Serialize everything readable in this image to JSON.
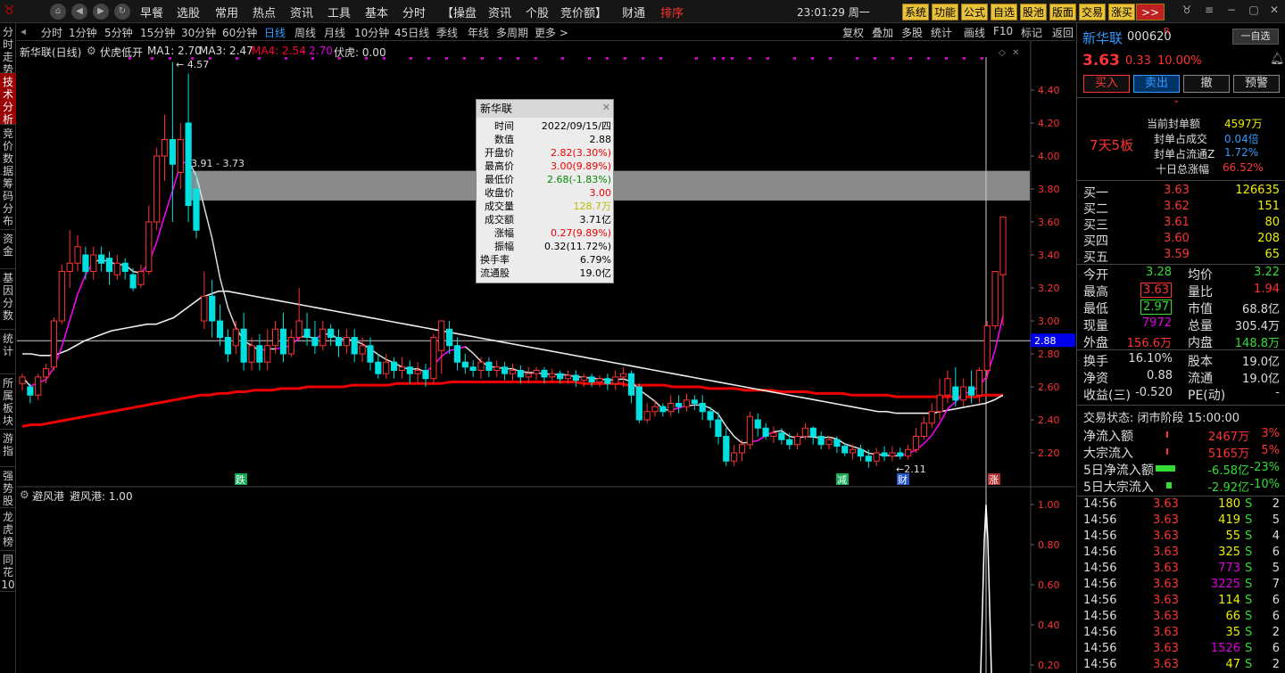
{
  "topbar": {
    "menus": [
      "早餐",
      "选股",
      "常用",
      "热点",
      "资讯",
      "工具",
      "基本",
      "分时",
      "【操盘",
      "资讯",
      "个股",
      "竞价额】",
      "财通",
      "排序"
    ],
    "clock": "23:01:29 周一",
    "tool_buttons": [
      "系统",
      "功能",
      "公式",
      "自选",
      "股池",
      "版面",
      "交易",
      "涨买"
    ]
  },
  "lefttabs": [
    "分时走势",
    "技术分析",
    "竞价数据",
    "筹码分布",
    "资金",
    "基因分数",
    "统计",
    "所属板块",
    "游指",
    "强势股",
    "龙虎榜",
    "同花10"
  ],
  "periods": [
    "分时",
    "1分钟",
    "5分钟",
    "15分钟",
    "30分钟",
    "60分钟",
    "日线",
    "周线",
    "月线",
    "10分钟",
    "45日线",
    "季线",
    "年线",
    "多周期",
    "更多 >"
  ],
  "active_period": "日线",
  "right_tools": [
    "复权",
    "叠加",
    "多股",
    "统计",
    "画线",
    "F10",
    "标记",
    "返回"
  ],
  "indicator_line": {
    "name": "新华联(日线)",
    "formula": "伏虎低开",
    "ma1": "MA1: 2.70",
    "ma3": "MA3: 2.47",
    "ma4": "MA4: 2.54",
    "ma4b": "- 2.70",
    "fuhu": "伏虎: 0.00"
  },
  "sub_indicator": {
    "name": "避风港",
    "value": "避风港: 1.00"
  },
  "annotations": {
    "high": "4.57",
    "range": "3.91 - 3.73",
    "low": "2.11",
    "crosshair": "2.88",
    "m1": "跌",
    "m2": "减",
    "m3": "财",
    "m4": "涨"
  },
  "tooltip": {
    "title": "新华联",
    "rows": [
      [
        "时间",
        "2022/09/15/四"
      ],
      [
        "数值",
        "2.88"
      ],
      [
        "开盘价",
        "2.82(3.30%)"
      ],
      [
        "最高价",
        "3.00(9.89%)"
      ],
      [
        "最低价",
        "2.68(-1.83%)"
      ],
      [
        "收盘价",
        "3.00"
      ],
      [
        "成交量",
        "128.7万"
      ],
      [
        "成交额",
        "3.71亿"
      ],
      [
        "涨幅",
        "0.27(9.89%)"
      ],
      [
        "振幅",
        "0.32(11.72%)"
      ],
      [
        "换手率",
        "6.79%"
      ],
      [
        "流通股",
        "19.0亿"
      ]
    ]
  },
  "stock": {
    "name": "新华联",
    "code": "000620",
    "flag": "R",
    "watch": "一自选",
    "price": "3.63",
    "change": "0.33",
    "pct": "10.00%"
  },
  "actions": [
    "买入",
    "卖出",
    "撤",
    "预警"
  ],
  "limit": {
    "streak": "7天5板",
    "rows": [
      [
        "当前封单额",
        "4597万"
      ],
      [
        "封单占成交",
        "0.04倍"
      ],
      [
        "封单占流通Z",
        "1.72%"
      ],
      [
        "十日总涨幅",
        "66.52%"
      ]
    ]
  },
  "orderbook": [
    [
      "买一",
      "3.63",
      "126635"
    ],
    [
      "买二",
      "3.62",
      "151"
    ],
    [
      "买三",
      "3.61",
      "80"
    ],
    [
      "买四",
      "3.60",
      "208"
    ],
    [
      "买五",
      "3.59",
      "65"
    ]
  ],
  "stats": [
    [
      "今开",
      "3.28",
      "均价",
      "3.22"
    ],
    [
      "最高",
      "3.63",
      "量比",
      "1.94"
    ],
    [
      "最低",
      "2.97",
      "市值",
      "68.8亿"
    ],
    [
      "现量",
      "7972",
      "总量",
      "305.4万"
    ],
    [
      "外盘",
      "156.6万",
      "内盘",
      "148.8万"
    ]
  ],
  "stats2": [
    [
      "换手",
      "16.10%",
      "股本",
      "19.0亿"
    ],
    [
      "净资",
      "0.88",
      "流通",
      "19.0亿"
    ],
    [
      "收益(三)",
      "-0.520",
      "PE(动)",
      "-"
    ]
  ],
  "trade_status": "交易状态: 闭市阶段 15:00:00",
  "flows": [
    [
      "净流入额",
      "2467万",
      "3%"
    ],
    [
      "大宗流入",
      "5165万",
      "5%"
    ],
    [
      "5日净流入额",
      "-6.58亿",
      "-23%"
    ],
    [
      "5日大宗流入",
      "-2.92亿",
      "-10%"
    ]
  ],
  "ticks": [
    [
      "14:56",
      "3.63",
      "180",
      "S",
      "2"
    ],
    [
      "14:56",
      "3.63",
      "419",
      "S",
      "5"
    ],
    [
      "14:56",
      "3.63",
      "55",
      "S",
      "4"
    ],
    [
      "14:56",
      "3.63",
      "325",
      "S",
      "6"
    ],
    [
      "14:56",
      "3.63",
      "773",
      "S",
      "5"
    ],
    [
      "14:56",
      "3.63",
      "3225",
      "S",
      "7"
    ],
    [
      "14:56",
      "3.63",
      "114",
      "S",
      "6"
    ],
    [
      "14:56",
      "3.63",
      "66",
      "S",
      "6"
    ],
    [
      "14:56",
      "3.63",
      "35",
      "S",
      "2"
    ],
    [
      "14:56",
      "3.63",
      "1526",
      "S",
      "6"
    ],
    [
      "14:56",
      "3.63",
      "47",
      "S",
      "2"
    ]
  ],
  "price_axis": [
    "4.40",
    "4.20",
    "4.00",
    "3.80",
    "3.60",
    "3.40",
    "3.20",
    "3.00",
    "2.80",
    "2.60",
    "2.40",
    "2.20"
  ],
  "sub_axis": [
    "1.00",
    "0.80",
    "0.60",
    "0.40",
    "0.20"
  ],
  "candles": [
    [
      2.62,
      2.66,
      2.58,
      2.68
    ],
    [
      2.6,
      2.55,
      2.5,
      2.62
    ],
    [
      2.55,
      2.66,
      2.52,
      2.68
    ],
    [
      2.66,
      2.71,
      2.62,
      2.74
    ],
    [
      2.72,
      3.0,
      2.7,
      3.02
    ],
    [
      3.0,
      3.3,
      2.98,
      3.34
    ],
    [
      3.3,
      3.35,
      3.2,
      3.55
    ],
    [
      3.35,
      3.45,
      3.3,
      3.52
    ],
    [
      3.4,
      3.3,
      3.25,
      3.45
    ],
    [
      3.3,
      3.4,
      3.25,
      3.45
    ],
    [
      3.4,
      3.35,
      3.3,
      3.45
    ],
    [
      3.38,
      3.3,
      3.22,
      3.42
    ],
    [
      3.28,
      3.35,
      3.25,
      3.4
    ],
    [
      3.35,
      3.3,
      3.25,
      3.38
    ],
    [
      3.28,
      3.2,
      3.18,
      3.32
    ],
    [
      3.22,
      3.3,
      3.2,
      3.34
    ],
    [
      3.3,
      3.6,
      3.28,
      3.7
    ],
    [
      3.6,
      4.0,
      3.55,
      4.05
    ],
    [
      4.0,
      4.1,
      3.85,
      4.25
    ],
    [
      4.1,
      3.95,
      3.6,
      4.57
    ],
    [
      3.9,
      4.1,
      3.8,
      4.2
    ],
    [
      4.2,
      3.7,
      3.6,
      4.5
    ],
    [
      3.8,
      3.55,
      3.5,
      3.9
    ],
    [
      3.0,
      3.15,
      2.95,
      3.3
    ],
    [
      3.15,
      3.0,
      2.9,
      3.25
    ],
    [
      3.0,
      2.9,
      2.85,
      3.1
    ],
    [
      2.9,
      2.8,
      2.75,
      2.95
    ],
    [
      2.85,
      2.95,
      2.8,
      3.0
    ],
    [
      2.95,
      2.75,
      2.7,
      3.05
    ],
    [
      2.75,
      2.85,
      2.7,
      2.9
    ],
    [
      2.85,
      2.75,
      2.7,
      2.92
    ],
    [
      2.75,
      2.85,
      2.7,
      2.95
    ],
    [
      2.85,
      2.95,
      2.8,
      3.0
    ],
    [
      2.95,
      2.8,
      2.75,
      3.05
    ],
    [
      2.8,
      2.9,
      2.78,
      2.95
    ],
    [
      2.9,
      3.0,
      2.88,
      3.2
    ],
    [
      2.95,
      2.9,
      2.85,
      3.05
    ],
    [
      2.9,
      2.85,
      2.8,
      3.0
    ],
    [
      2.85,
      2.95,
      2.82,
      3.0
    ],
    [
      2.95,
      2.9,
      2.85,
      2.98
    ],
    [
      2.9,
      2.85,
      2.78,
      2.95
    ],
    [
      2.85,
      2.9,
      2.8,
      2.95
    ],
    [
      2.9,
      2.8,
      2.75,
      2.95
    ],
    [
      2.8,
      2.85,
      2.75,
      2.9
    ],
    [
      2.85,
      2.75,
      2.7,
      2.9
    ],
    [
      2.75,
      2.68,
      2.65,
      2.8
    ],
    [
      2.68,
      2.75,
      2.65,
      2.8
    ],
    [
      2.75,
      2.7,
      2.65,
      2.78
    ],
    [
      2.7,
      2.72,
      2.65,
      2.78
    ],
    [
      2.72,
      2.68,
      2.62,
      2.76
    ],
    [
      2.68,
      2.7,
      2.62,
      2.75
    ],
    [
      2.7,
      2.65,
      2.6,
      2.74
    ],
    [
      2.65,
      2.9,
      2.62,
      2.92
    ],
    [
      2.82,
      3.0,
      2.68,
      3.0
    ],
    [
      2.95,
      2.85,
      2.8,
      3.0
    ],
    [
      2.85,
      2.75,
      2.7,
      2.9
    ],
    [
      2.75,
      2.72,
      2.68,
      2.8
    ],
    [
      2.72,
      2.7,
      2.66,
      2.76
    ],
    [
      2.7,
      2.75,
      2.65,
      2.78
    ],
    [
      2.75,
      2.7,
      2.66,
      2.78
    ],
    [
      2.7,
      2.72,
      2.66,
      2.76
    ],
    [
      2.72,
      2.68,
      2.64,
      2.75
    ],
    [
      2.68,
      2.7,
      2.64,
      2.74
    ],
    [
      2.7,
      2.66,
      2.62,
      2.73
    ],
    [
      2.66,
      2.68,
      2.62,
      2.72
    ],
    [
      2.68,
      2.7,
      2.64,
      2.72
    ],
    [
      2.7,
      2.66,
      2.62,
      2.72
    ],
    [
      2.66,
      2.68,
      2.63,
      2.71
    ],
    [
      2.68,
      2.65,
      2.62,
      2.7
    ],
    [
      2.65,
      2.67,
      2.62,
      2.7
    ],
    [
      2.67,
      2.64,
      2.6,
      2.7
    ],
    [
      2.64,
      2.66,
      2.6,
      2.68
    ],
    [
      2.66,
      2.63,
      2.6,
      2.68
    ],
    [
      2.63,
      2.65,
      2.6,
      2.67
    ],
    [
      2.65,
      2.62,
      2.58,
      2.68
    ],
    [
      2.62,
      2.66,
      2.58,
      2.7
    ],
    [
      2.66,
      2.68,
      2.6,
      2.72
    ],
    [
      2.68,
      2.55,
      2.5,
      2.7
    ],
    [
      2.6,
      2.4,
      2.38,
      2.62
    ],
    [
      2.4,
      2.45,
      2.38,
      2.5
    ],
    [
      2.45,
      2.48,
      2.42,
      2.52
    ],
    [
      2.48,
      2.45,
      2.42,
      2.5
    ],
    [
      2.45,
      2.5,
      2.42,
      2.55
    ],
    [
      2.5,
      2.48,
      2.44,
      2.55
    ],
    [
      2.48,
      2.52,
      2.45,
      2.56
    ],
    [
      2.52,
      2.5,
      2.46,
      2.55
    ],
    [
      2.5,
      2.45,
      2.4,
      2.55
    ],
    [
      2.45,
      2.4,
      2.35,
      2.48
    ],
    [
      2.4,
      2.3,
      2.25,
      2.45
    ],
    [
      2.3,
      2.15,
      2.12,
      2.35
    ],
    [
      2.15,
      2.2,
      2.12,
      2.25
    ],
    [
      2.2,
      2.25,
      2.15,
      2.28
    ],
    [
      2.25,
      2.42,
      2.22,
      2.45
    ],
    [
      2.4,
      2.35,
      2.3,
      2.44
    ],
    [
      2.35,
      2.3,
      2.28,
      2.38
    ],
    [
      2.3,
      2.32,
      2.26,
      2.36
    ],
    [
      2.32,
      2.28,
      2.25,
      2.35
    ],
    [
      2.28,
      2.25,
      2.22,
      2.32
    ],
    [
      2.25,
      2.3,
      2.22,
      2.32
    ],
    [
      2.3,
      2.35,
      2.28,
      2.38
    ],
    [
      2.35,
      2.3,
      2.25,
      2.36
    ],
    [
      2.3,
      2.25,
      2.22,
      2.33
    ],
    [
      2.25,
      2.28,
      2.22,
      2.3
    ],
    [
      2.28,
      2.24,
      2.2,
      2.3
    ],
    [
      2.24,
      2.2,
      2.18,
      2.26
    ],
    [
      2.2,
      2.22,
      2.16,
      2.25
    ],
    [
      2.22,
      2.18,
      2.15,
      2.25
    ],
    [
      2.18,
      2.15,
      2.11,
      2.22
    ],
    [
      2.15,
      2.2,
      2.12,
      2.23
    ],
    [
      2.2,
      2.18,
      2.15,
      2.24
    ],
    [
      2.18,
      2.2,
      2.15,
      2.24
    ],
    [
      2.2,
      2.18,
      2.16,
      2.23
    ],
    [
      2.18,
      2.22,
      2.16,
      2.25
    ],
    [
      2.22,
      2.3,
      2.2,
      2.35
    ],
    [
      2.3,
      2.38,
      2.28,
      2.42
    ],
    [
      2.38,
      2.45,
      2.35,
      2.5
    ],
    [
      2.45,
      2.55,
      2.4,
      2.65
    ],
    [
      2.55,
      2.65,
      2.5,
      2.7
    ],
    [
      2.6,
      2.52,
      2.48,
      2.72
    ],
    [
      2.52,
      2.6,
      2.48,
      2.65
    ],
    [
      2.6,
      2.55,
      2.5,
      2.7
    ],
    [
      2.55,
      2.7,
      2.5,
      2.72
    ],
    [
      2.7,
      2.97,
      2.65,
      3.0
    ],
    [
      2.97,
      3.3,
      2.95,
      3.3
    ],
    [
      3.28,
      3.63,
      2.97,
      3.63
    ]
  ],
  "ma_white": [
    2.8,
    2.8,
    2.79,
    2.79,
    2.8,
    2.82,
    2.85,
    2.88,
    2.9,
    2.92,
    2.94,
    2.95,
    2.96,
    2.97,
    2.98,
    2.98,
    3.0,
    3.02,
    3.06,
    3.1,
    3.14,
    3.16,
    3.18,
    3.18,
    3.17,
    3.16,
    3.15,
    3.14,
    3.13,
    3.12,
    3.11,
    3.1,
    3.09,
    3.08,
    3.07,
    3.06,
    3.05,
    3.04,
    3.03,
    3.02,
    3.01,
    3.0,
    2.99,
    2.98,
    2.97,
    2.96,
    2.95,
    2.94,
    2.93,
    2.92,
    2.91,
    2.9,
    2.89,
    2.88,
    2.87,
    2.86,
    2.85,
    2.84,
    2.83,
    2.82,
    2.81,
    2.8,
    2.79,
    2.78,
    2.77,
    2.76,
    2.75,
    2.74,
    2.73,
    2.72,
    2.71,
    2.7,
    2.69,
    2.68,
    2.67,
    2.66,
    2.65,
    2.64,
    2.63,
    2.62,
    2.61,
    2.6,
    2.59,
    2.58,
    2.57,
    2.56,
    2.55,
    2.54,
    2.53,
    2.52,
    2.51,
    2.5,
    2.49,
    2.48,
    2.47,
    2.46,
    2.45,
    2.45,
    2.44,
    2.44,
    2.44,
    2.44,
    2.44,
    2.45,
    2.46,
    2.47,
    2.48,
    2.49,
    2.5,
    2.52,
    2.55
  ],
  "ma_red": [
    2.36,
    2.37,
    2.37,
    2.38,
    2.39,
    2.4,
    2.41,
    2.42,
    2.43,
    2.44,
    2.45,
    2.46,
    2.47,
    2.48,
    2.49,
    2.5,
    2.51,
    2.52,
    2.53,
    2.54,
    2.55,
    2.55,
    2.56,
    2.56,
    2.57,
    2.57,
    2.58,
    2.58,
    2.58,
    2.59,
    2.59,
    2.59,
    2.6,
    2.6,
    2.6,
    2.6,
    2.6,
    2.61,
    2.61,
    2.61,
    2.61,
    2.61,
    2.62,
    2.62,
    2.62,
    2.62,
    2.62,
    2.62,
    2.63,
    2.63,
    2.63,
    2.63,
    2.63,
    2.63,
    2.63,
    2.63,
    2.63,
    2.63,
    2.63,
    2.63,
    2.63,
    2.63,
    2.63,
    2.62,
    2.62,
    2.62,
    2.62,
    2.62,
    2.61,
    2.61,
    2.61,
    2.61,
    2.61,
    2.6,
    2.6,
    2.6,
    2.6,
    2.59,
    2.59,
    2.59,
    2.59,
    2.58,
    2.58,
    2.58,
    2.58,
    2.57,
    2.57,
    2.57,
    2.57,
    2.56,
    2.56,
    2.56,
    2.56,
    2.55,
    2.55,
    2.55,
    2.55,
    2.55,
    2.54,
    2.54,
    2.54,
    2.54,
    2.54,
    2.54,
    2.54,
    2.54,
    2.54,
    2.54,
    2.55,
    2.55,
    2.55
  ]
}
